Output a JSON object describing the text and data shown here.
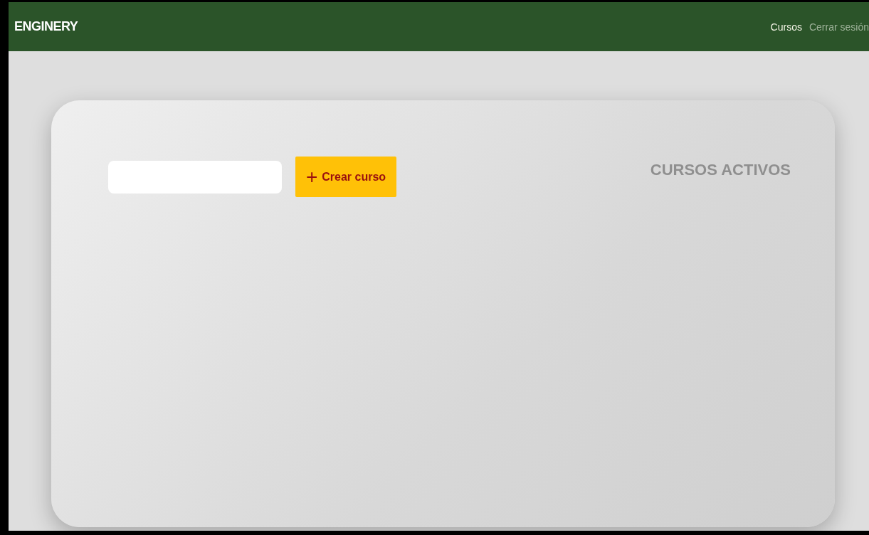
{
  "navbar": {
    "brand": "ENGINERY",
    "links": [
      {
        "label": "Cursos",
        "selected": true
      },
      {
        "label": "Cerrar sesión",
        "selected": false
      }
    ]
  },
  "main": {
    "create_button": {
      "icon": "+",
      "label": "Crear curso"
    },
    "heading": "CURSOS ACTIVOS"
  }
}
